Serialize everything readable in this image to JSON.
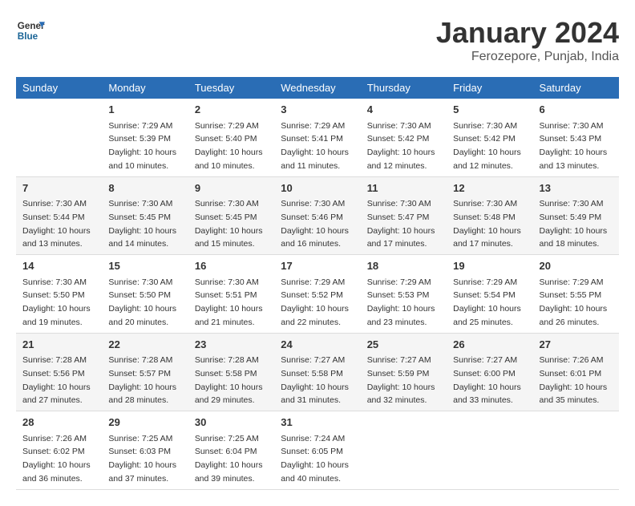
{
  "header": {
    "logo_line1": "General",
    "logo_line2": "Blue",
    "month_year": "January 2024",
    "location": "Ferozepore, Punjab, India"
  },
  "weekdays": [
    "Sunday",
    "Monday",
    "Tuesday",
    "Wednesday",
    "Thursday",
    "Friday",
    "Saturday"
  ],
  "weeks": [
    [
      {
        "day": "",
        "sunrise": "",
        "sunset": "",
        "daylight": ""
      },
      {
        "day": "1",
        "sunrise": "Sunrise: 7:29 AM",
        "sunset": "Sunset: 5:39 PM",
        "daylight": "Daylight: 10 hours and 10 minutes."
      },
      {
        "day": "2",
        "sunrise": "Sunrise: 7:29 AM",
        "sunset": "Sunset: 5:40 PM",
        "daylight": "Daylight: 10 hours and 10 minutes."
      },
      {
        "day": "3",
        "sunrise": "Sunrise: 7:29 AM",
        "sunset": "Sunset: 5:41 PM",
        "daylight": "Daylight: 10 hours and 11 minutes."
      },
      {
        "day": "4",
        "sunrise": "Sunrise: 7:30 AM",
        "sunset": "Sunset: 5:42 PM",
        "daylight": "Daylight: 10 hours and 12 minutes."
      },
      {
        "day": "5",
        "sunrise": "Sunrise: 7:30 AM",
        "sunset": "Sunset: 5:42 PM",
        "daylight": "Daylight: 10 hours and 12 minutes."
      },
      {
        "day": "6",
        "sunrise": "Sunrise: 7:30 AM",
        "sunset": "Sunset: 5:43 PM",
        "daylight": "Daylight: 10 hours and 13 minutes."
      }
    ],
    [
      {
        "day": "7",
        "sunrise": "Sunrise: 7:30 AM",
        "sunset": "Sunset: 5:44 PM",
        "daylight": "Daylight: 10 hours and 13 minutes."
      },
      {
        "day": "8",
        "sunrise": "Sunrise: 7:30 AM",
        "sunset": "Sunset: 5:45 PM",
        "daylight": "Daylight: 10 hours and 14 minutes."
      },
      {
        "day": "9",
        "sunrise": "Sunrise: 7:30 AM",
        "sunset": "Sunset: 5:45 PM",
        "daylight": "Daylight: 10 hours and 15 minutes."
      },
      {
        "day": "10",
        "sunrise": "Sunrise: 7:30 AM",
        "sunset": "Sunset: 5:46 PM",
        "daylight": "Daylight: 10 hours and 16 minutes."
      },
      {
        "day": "11",
        "sunrise": "Sunrise: 7:30 AM",
        "sunset": "Sunset: 5:47 PM",
        "daylight": "Daylight: 10 hours and 17 minutes."
      },
      {
        "day": "12",
        "sunrise": "Sunrise: 7:30 AM",
        "sunset": "Sunset: 5:48 PM",
        "daylight": "Daylight: 10 hours and 17 minutes."
      },
      {
        "day": "13",
        "sunrise": "Sunrise: 7:30 AM",
        "sunset": "Sunset: 5:49 PM",
        "daylight": "Daylight: 10 hours and 18 minutes."
      }
    ],
    [
      {
        "day": "14",
        "sunrise": "Sunrise: 7:30 AM",
        "sunset": "Sunset: 5:50 PM",
        "daylight": "Daylight: 10 hours and 19 minutes."
      },
      {
        "day": "15",
        "sunrise": "Sunrise: 7:30 AM",
        "sunset": "Sunset: 5:50 PM",
        "daylight": "Daylight: 10 hours and 20 minutes."
      },
      {
        "day": "16",
        "sunrise": "Sunrise: 7:30 AM",
        "sunset": "Sunset: 5:51 PM",
        "daylight": "Daylight: 10 hours and 21 minutes."
      },
      {
        "day": "17",
        "sunrise": "Sunrise: 7:29 AM",
        "sunset": "Sunset: 5:52 PM",
        "daylight": "Daylight: 10 hours and 22 minutes."
      },
      {
        "day": "18",
        "sunrise": "Sunrise: 7:29 AM",
        "sunset": "Sunset: 5:53 PM",
        "daylight": "Daylight: 10 hours and 23 minutes."
      },
      {
        "day": "19",
        "sunrise": "Sunrise: 7:29 AM",
        "sunset": "Sunset: 5:54 PM",
        "daylight": "Daylight: 10 hours and 25 minutes."
      },
      {
        "day": "20",
        "sunrise": "Sunrise: 7:29 AM",
        "sunset": "Sunset: 5:55 PM",
        "daylight": "Daylight: 10 hours and 26 minutes."
      }
    ],
    [
      {
        "day": "21",
        "sunrise": "Sunrise: 7:28 AM",
        "sunset": "Sunset: 5:56 PM",
        "daylight": "Daylight: 10 hours and 27 minutes."
      },
      {
        "day": "22",
        "sunrise": "Sunrise: 7:28 AM",
        "sunset": "Sunset: 5:57 PM",
        "daylight": "Daylight: 10 hours and 28 minutes."
      },
      {
        "day": "23",
        "sunrise": "Sunrise: 7:28 AM",
        "sunset": "Sunset: 5:58 PM",
        "daylight": "Daylight: 10 hours and 29 minutes."
      },
      {
        "day": "24",
        "sunrise": "Sunrise: 7:27 AM",
        "sunset": "Sunset: 5:58 PM",
        "daylight": "Daylight: 10 hours and 31 minutes."
      },
      {
        "day": "25",
        "sunrise": "Sunrise: 7:27 AM",
        "sunset": "Sunset: 5:59 PM",
        "daylight": "Daylight: 10 hours and 32 minutes."
      },
      {
        "day": "26",
        "sunrise": "Sunrise: 7:27 AM",
        "sunset": "Sunset: 6:00 PM",
        "daylight": "Daylight: 10 hours and 33 minutes."
      },
      {
        "day": "27",
        "sunrise": "Sunrise: 7:26 AM",
        "sunset": "Sunset: 6:01 PM",
        "daylight": "Daylight: 10 hours and 35 minutes."
      }
    ],
    [
      {
        "day": "28",
        "sunrise": "Sunrise: 7:26 AM",
        "sunset": "Sunset: 6:02 PM",
        "daylight": "Daylight: 10 hours and 36 minutes."
      },
      {
        "day": "29",
        "sunrise": "Sunrise: 7:25 AM",
        "sunset": "Sunset: 6:03 PM",
        "daylight": "Daylight: 10 hours and 37 minutes."
      },
      {
        "day": "30",
        "sunrise": "Sunrise: 7:25 AM",
        "sunset": "Sunset: 6:04 PM",
        "daylight": "Daylight: 10 hours and 39 minutes."
      },
      {
        "day": "31",
        "sunrise": "Sunrise: 7:24 AM",
        "sunset": "Sunset: 6:05 PM",
        "daylight": "Daylight: 10 hours and 40 minutes."
      },
      {
        "day": "",
        "sunrise": "",
        "sunset": "",
        "daylight": ""
      },
      {
        "day": "",
        "sunrise": "",
        "sunset": "",
        "daylight": ""
      },
      {
        "day": "",
        "sunrise": "",
        "sunset": "",
        "daylight": ""
      }
    ]
  ]
}
